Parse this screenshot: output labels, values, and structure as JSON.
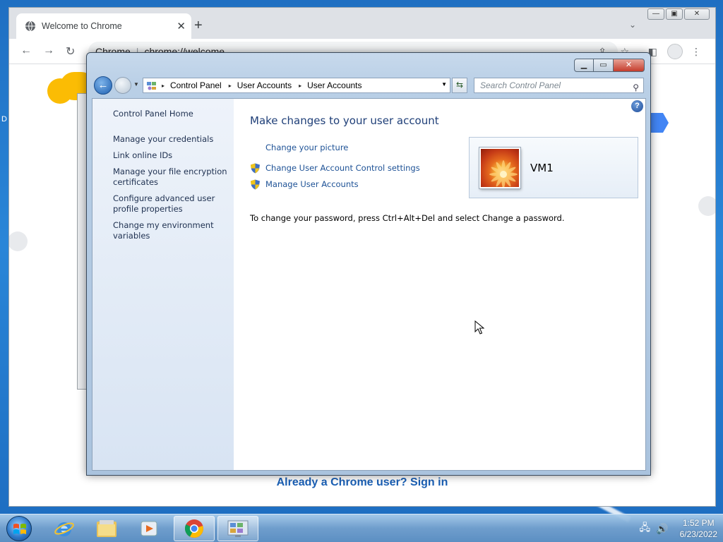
{
  "desktop": {
    "icon_label_fragment": "D"
  },
  "chrome": {
    "tab_title": "Welcome to Chrome",
    "tab_close": "✕",
    "new_tab": "+",
    "tab_search": "⌄",
    "win_minimize": "—",
    "win_restore": "▣",
    "win_close": "✕",
    "back": "←",
    "forward": "→",
    "reload": "↻",
    "omnibox_site": "Chrome",
    "omnibox_url": "chrome://welcome",
    "share": "⇪",
    "star": "☆",
    "sidepanel": "◧",
    "menu": "⋮",
    "signin_link": "Already a Chrome user? Sign in"
  },
  "control_panel": {
    "caption": {
      "minimize": "▁",
      "maximize": "▭",
      "close": "✕"
    },
    "nav": {
      "back": "←",
      "dropdown": "▼"
    },
    "breadcrumb": [
      "Control Panel",
      "User Accounts",
      "User Accounts"
    ],
    "breadcrumb_sep": "▸",
    "address_dropdown": "▼",
    "refresh": "⇆",
    "search_placeholder": "Search Control Panel",
    "search_icon": "⚲",
    "help": "?",
    "sidebar": {
      "home": "Control Panel Home",
      "links": [
        "Manage your credentials",
        "Link online IDs",
        "Manage your file encryption certificates",
        "Configure advanced user profile properties",
        "Change my environment variables"
      ]
    },
    "main": {
      "heading": "Make changes to your user account",
      "tasks": [
        {
          "label": "Change your picture",
          "shield": false
        },
        {
          "label": "Change User Account Control settings",
          "shield": true
        },
        {
          "label": "Manage User Accounts",
          "shield": true
        }
      ],
      "password_note": "To change your password, press Ctrl+Alt+Del and select Change a password."
    },
    "user": {
      "name": "VM1"
    }
  },
  "taskbar": {
    "apps": [
      {
        "name": "internet-explorer"
      },
      {
        "name": "windows-explorer"
      },
      {
        "name": "media-player"
      },
      {
        "name": "google-chrome"
      },
      {
        "name": "control-panel"
      }
    ],
    "clock_time": "1:52 PM",
    "clock_date": "6/23/2022",
    "tray_network": "🖧",
    "tray_volume": "🔊"
  },
  "colors": {
    "link": "#1e5296",
    "heading": "#1f3f78",
    "chrome_link": "#1a5fb4",
    "taskbar": "#5f91c3"
  }
}
